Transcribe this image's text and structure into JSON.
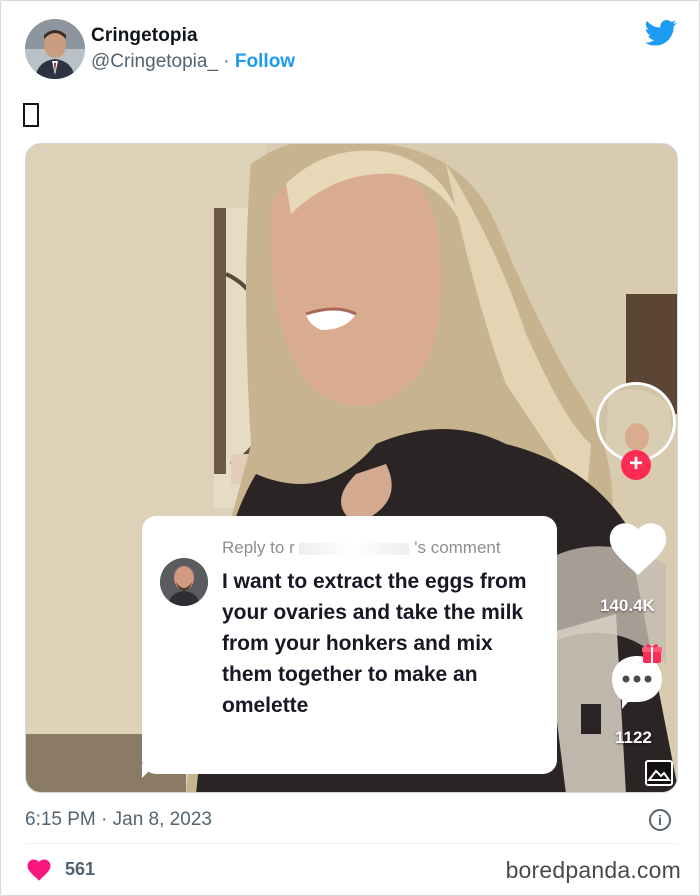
{
  "tweet": {
    "display_name": "Cringetopia",
    "handle": "@Cringetopia_",
    "separator": " · ",
    "follow_label": "Follow",
    "timestamp": "6:15 PM · Jan 8, 2023",
    "like_count": "561"
  },
  "media": {
    "reply_header_prefix": "Reply to r",
    "reply_header_suffix": "'s comment",
    "reply_text": "I want to extract the eggs from your ovaries and take the milk from your honkers and mix them together to make an omelette",
    "likes": "140.4K",
    "comments": "1122",
    "plus": "+"
  },
  "footer": {
    "watermark": "boredpanda.com",
    "info_glyph": "i"
  },
  "icons": {
    "brand": "twitter-bird-icon",
    "like": "heart-icon",
    "info": "info-icon"
  },
  "colors": {
    "twitter_blue": "#1d9bf0",
    "heart_red": "#f91880",
    "tiktok_red": "#fe2c55",
    "muted_text": "#536471"
  }
}
